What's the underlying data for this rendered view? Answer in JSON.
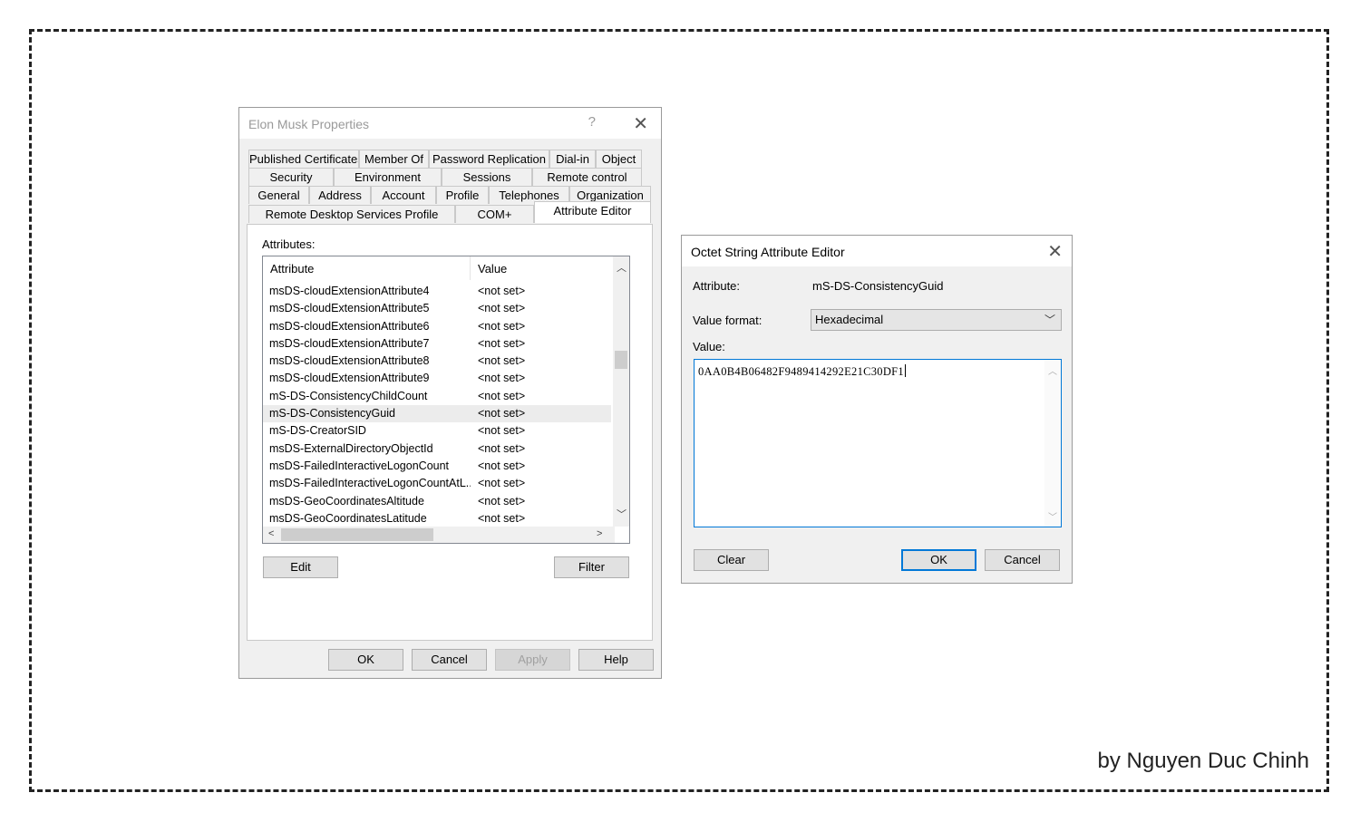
{
  "credit": "by Nguyen Duc Chinh",
  "props_dialog": {
    "title": "Elon Musk Properties",
    "help": "?",
    "close": "✕",
    "tabs_row1": [
      "Published Certificates",
      "Member Of",
      "Password Replication",
      "Dial-in",
      "Object"
    ],
    "tabs_row2": [
      "Security",
      "Environment",
      "Sessions",
      "Remote control"
    ],
    "tabs_row3": [
      "General",
      "Address",
      "Account",
      "Profile",
      "Telephones",
      "Organization"
    ],
    "tabs_row4": [
      "Remote Desktop Services Profile",
      "COM+",
      "Attribute Editor"
    ],
    "active_tab": "Attribute Editor",
    "attributes_label": "Attributes:",
    "columns": [
      "Attribute",
      "Value"
    ],
    "rows": [
      {
        "attr": "msDS-cloudExtensionAttribute4",
        "value": "<not set>"
      },
      {
        "attr": "msDS-cloudExtensionAttribute5",
        "value": "<not set>"
      },
      {
        "attr": "msDS-cloudExtensionAttribute6",
        "value": "<not set>"
      },
      {
        "attr": "msDS-cloudExtensionAttribute7",
        "value": "<not set>"
      },
      {
        "attr": "msDS-cloudExtensionAttribute8",
        "value": "<not set>"
      },
      {
        "attr": "msDS-cloudExtensionAttribute9",
        "value": "<not set>"
      },
      {
        "attr": "mS-DS-ConsistencyChildCount",
        "value": "<not set>"
      },
      {
        "attr": "mS-DS-ConsistencyGuid",
        "value": "<not set>"
      },
      {
        "attr": "mS-DS-CreatorSID",
        "value": "<not set>"
      },
      {
        "attr": "msDS-ExternalDirectoryObjectId",
        "value": "<not set>"
      },
      {
        "attr": "msDS-FailedInteractiveLogonCount",
        "value": "<not set>"
      },
      {
        "attr": "msDS-FailedInteractiveLogonCountAtL...",
        "value": "<not set>"
      },
      {
        "attr": "msDS-GeoCoordinatesAltitude",
        "value": "<not set>"
      },
      {
        "attr": "msDS-GeoCoordinatesLatitude",
        "value": "<not set>"
      }
    ],
    "selected_row": 7,
    "edit_button": "Edit",
    "filter_button": "Filter",
    "ok_button": "OK",
    "cancel_button": "Cancel",
    "apply_button": "Apply",
    "help_button": "Help"
  },
  "octet_dialog": {
    "title": "Octet String Attribute Editor",
    "close": "✕",
    "attribute_label": "Attribute:",
    "attribute_value": "mS-DS-ConsistencyGuid",
    "value_format_label": "Value format:",
    "value_format": "Hexadecimal",
    "value_label": "Value:",
    "value": "0AA0B4B06482F9489414292E21C30DF1",
    "clear_button": "Clear",
    "ok_button": "OK",
    "cancel_button": "Cancel"
  }
}
